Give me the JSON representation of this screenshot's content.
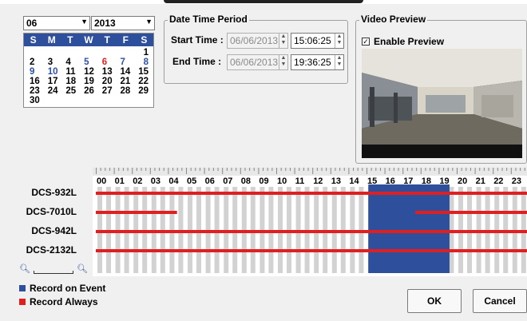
{
  "calendar": {
    "month": "06",
    "year": "2013",
    "weekday_headers": [
      "S",
      "M",
      "T",
      "W",
      "T",
      "F",
      "S"
    ],
    "weeks": [
      [
        "",
        "",
        "",
        "",
        "",
        "",
        "1"
      ],
      [
        "2",
        "3",
        "4",
        "5",
        "6",
        "7",
        "8"
      ],
      [
        "9",
        "10",
        "11",
        "12",
        "13",
        "14",
        "15"
      ],
      [
        "16",
        "17",
        "18",
        "19",
        "20",
        "21",
        "22"
      ],
      [
        "23",
        "24",
        "25",
        "26",
        "27",
        "28",
        "29"
      ],
      [
        "30",
        "",
        "",
        "",
        "",
        "",
        ""
      ]
    ]
  },
  "period": {
    "title": "Date Time Period",
    "start_label": "Start Time :",
    "start_date": "06/06/2013",
    "start_time": "15:06:25",
    "end_label": "End Time :",
    "end_date": "06/06/2013",
    "end_time": "19:36:25"
  },
  "preview": {
    "title": "Video Preview",
    "enable_label": "Enable Preview",
    "enabled": true
  },
  "timeline": {
    "hours": [
      "00",
      "01",
      "02",
      "03",
      "04",
      "05",
      "06",
      "07",
      "08",
      "09",
      "10",
      "11",
      "12",
      "13",
      "14",
      "15",
      "16",
      "17",
      "18",
      "19",
      "20",
      "21",
      "22",
      "23"
    ],
    "selection_start_hour": 15.1,
    "selection_end_hour": 19.6,
    "cameras": [
      {
        "name": "DCS-932L",
        "segments": [
          [
            0,
            24
          ]
        ]
      },
      {
        "name": "DCS-7010L",
        "segments": [
          [
            0,
            4.5
          ],
          [
            17.7,
            24
          ]
        ]
      },
      {
        "name": "DCS-942L",
        "segments": [
          [
            0,
            24
          ]
        ]
      },
      {
        "name": "DCS-2132L",
        "segments": [
          [
            0,
            24
          ]
        ]
      }
    ]
  },
  "legend": {
    "event_label": "Record on Event",
    "always_label": "Record Always",
    "event_color": "#2e4f9c",
    "always_color": "#e02020"
  },
  "buttons": {
    "ok": "OK",
    "cancel": "Cancel"
  }
}
